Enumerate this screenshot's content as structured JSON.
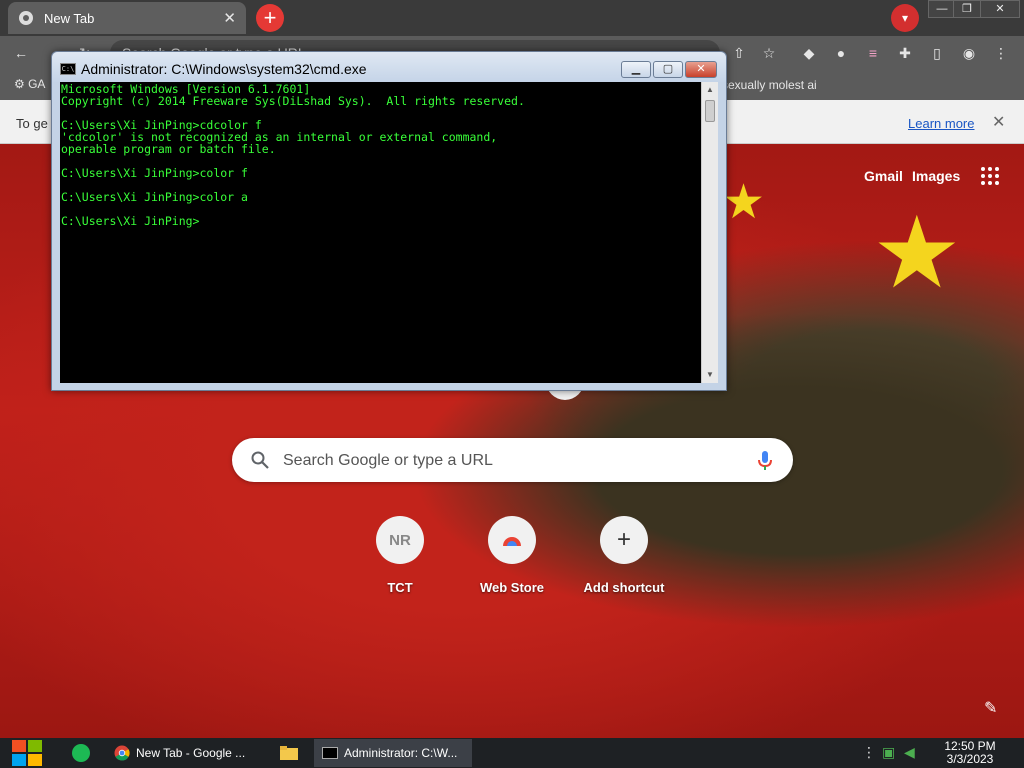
{
  "browser": {
    "tab_title": "New Tab",
    "omnibox_text": "Search Google or type a URL",
    "bookmarks": {
      "first": "GA",
      "ai": "sexually molest ai"
    },
    "infobar": {
      "text": "To ge",
      "learn_more": "Learn more"
    }
  },
  "ntp": {
    "gmail": "Gmail",
    "images": "Images",
    "search_placeholder": "Search Google or type a URL",
    "shortcuts": [
      {
        "initials": "NR",
        "label": "TCT"
      },
      {
        "initials": "",
        "label": "Web Store"
      },
      {
        "initials": "+",
        "label": "Add shortcut"
      }
    ]
  },
  "cmd": {
    "title": "Administrator: C:\\Windows\\system32\\cmd.exe",
    "output": "Microsoft Windows [Version 6.1.7601]\nCopyright (c) 2014 Freeware Sys(DiLshad Sys).  All rights reserved.\n\nC:\\Users\\Xi JinPing>cdcolor f\n'cdcolor' is not recognized as an internal or external command,\noperable program or batch file.\n\nC:\\Users\\Xi JinPing>color f\n\nC:\\Users\\Xi JinPing>color a\n\nC:\\Users\\Xi JinPing>"
  },
  "taskbar": {
    "chrome_task": "New Tab - Google ...",
    "cmd_task": "Administrator: C:\\W...",
    "time": "12:50 PM",
    "date": "3/3/2023"
  },
  "colors": {
    "console_text": "#39ff39",
    "console_bg": "#000000",
    "accent_red": "#e53935"
  }
}
